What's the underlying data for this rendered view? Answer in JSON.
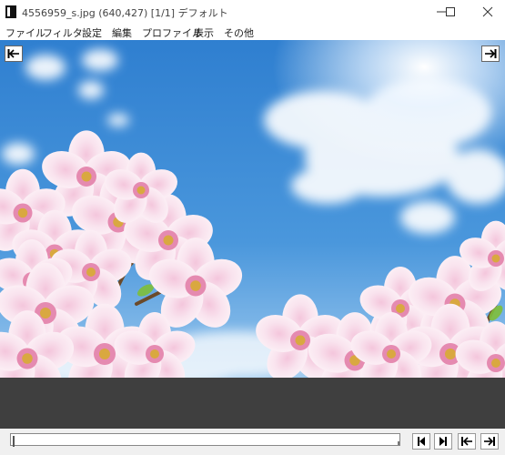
{
  "window": {
    "title": "4556959_s.jpg (640,427)  [1/1]  デフォルト"
  },
  "menu": {
    "items": [
      "ファイル",
      "フィルタ",
      "設定",
      "編集",
      "プロファイル",
      "表示",
      "その他"
    ]
  },
  "image": {
    "subject": "Cherry blossoms against a blue sky with white clouds"
  },
  "seek": {
    "position": 0
  },
  "colors": {
    "sky": "#3a88d4",
    "lower_panel": "#3f3f3f",
    "chrome": "#f0f0f0"
  }
}
